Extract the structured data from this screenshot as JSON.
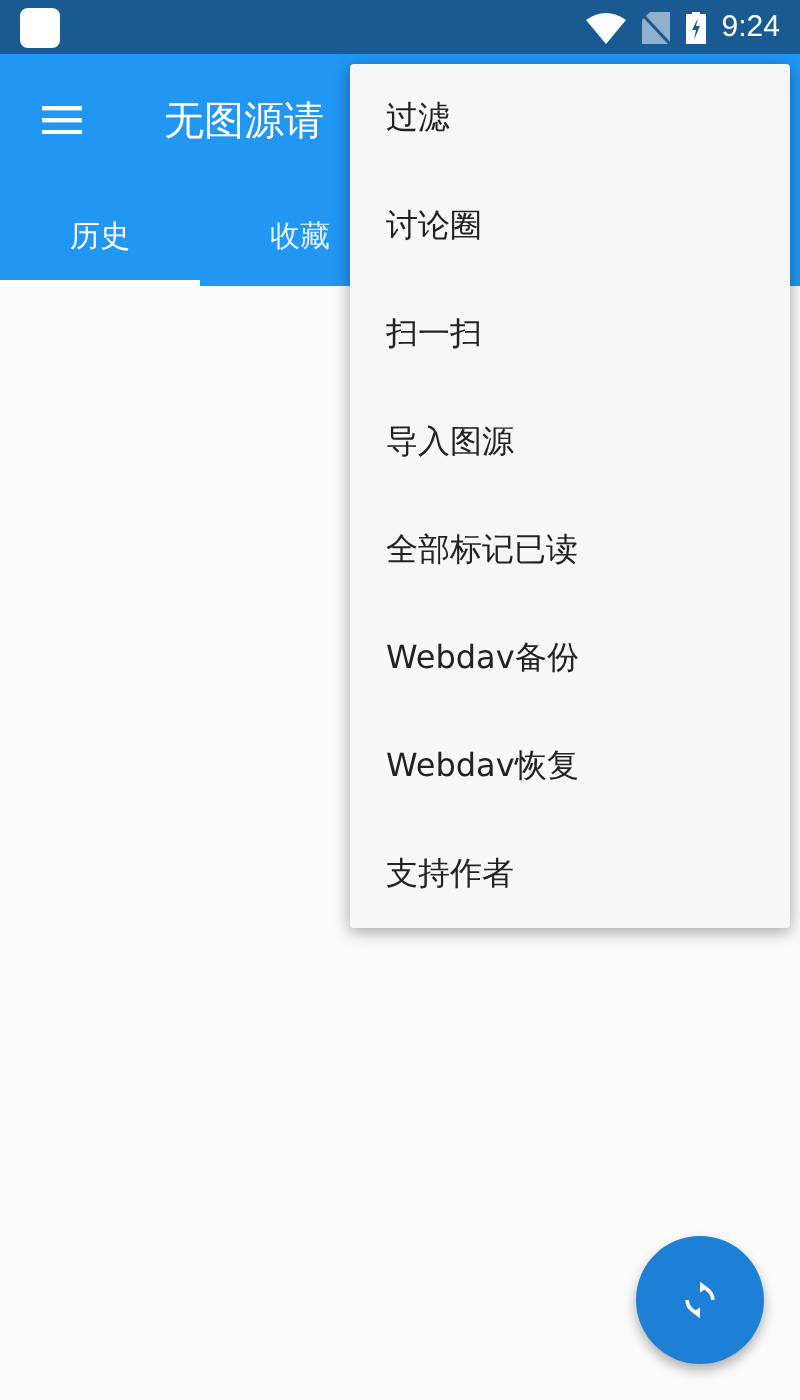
{
  "status_bar": {
    "time": "9:24"
  },
  "app_bar": {
    "title": "无图源请"
  },
  "tabs": [
    {
      "label": "历史",
      "selected": true
    },
    {
      "label": "收藏",
      "selected": false
    }
  ],
  "menu": {
    "items": [
      "过滤",
      "讨论圈",
      "扫一扫",
      "导入图源",
      "全部标记已读",
      "Webdav备份",
      "Webdav恢复",
      "支持作者"
    ]
  }
}
